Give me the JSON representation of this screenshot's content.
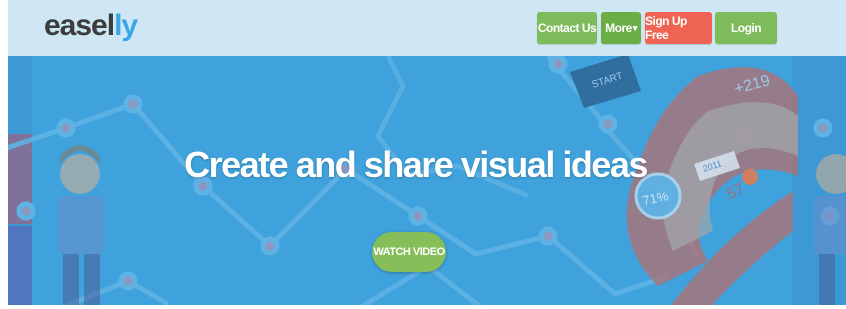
{
  "logo": {
    "part1": "easel",
    "part2": "ly"
  },
  "nav": {
    "contact_label": "Contact Us",
    "more_label": "More",
    "more_caret": "▾",
    "signup_label": "Sign Up Free",
    "login_label": "Login"
  },
  "hero": {
    "title": "Create and share visual ideas",
    "watch_label": "WATCH VIDEO",
    "graphic": {
      "start_label": "START",
      "plus_label": "+219",
      "year_label": "2011",
      "percent_label": "71%",
      "number_label": "57"
    }
  },
  "colors": {
    "navbar": "#cfe7f4",
    "hero_bg": "#3fa2dc",
    "green": "#7dbb5b",
    "red": "#ef6352",
    "logo_accent": "#3aa7e3"
  }
}
